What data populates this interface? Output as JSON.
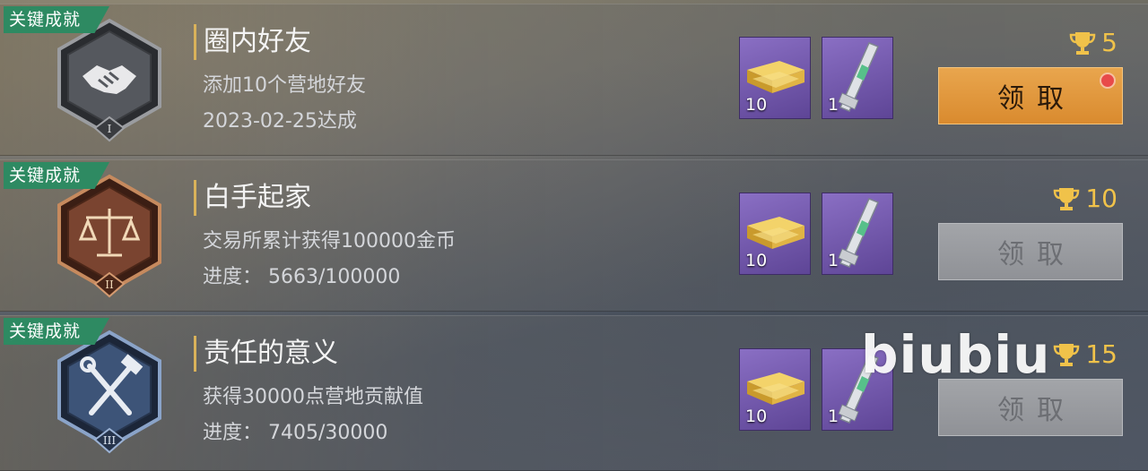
{
  "achievements": [
    {
      "tag": "关键成就",
      "title": "圈内好友",
      "description": "添加10个营地好友",
      "status": "2023-02-25达成",
      "badge_icon": "handshake-icon",
      "badge_tier": "I",
      "badge_color": "#5a5d63",
      "rewards": [
        {
          "icon": "gold-bars-icon",
          "qty": "10"
        },
        {
          "icon": "weapon-icon",
          "qty": "1"
        }
      ],
      "trophy_points": "5",
      "claim_label": "领取",
      "claim_state": "active",
      "has_notification": true
    },
    {
      "tag": "关键成就",
      "title": "白手起家",
      "description": "交易所累计获得100000金币",
      "status": "进度： 5663/100000",
      "badge_icon": "scales-icon",
      "badge_tier": "II",
      "badge_color": "#6b3c28",
      "rewards": [
        {
          "icon": "gold-bars-icon",
          "qty": "10"
        },
        {
          "icon": "weapon-icon",
          "qty": "1"
        }
      ],
      "trophy_points": "10",
      "claim_label": "领取",
      "claim_state": "disabled",
      "has_notification": false
    },
    {
      "tag": "关键成就",
      "title": "责任的意义",
      "description": "获得30000点营地贡献值",
      "status": "进度： 7405/30000",
      "badge_icon": "hammer-wrench-icon",
      "badge_tier": "III",
      "badge_color": "#3a4f72",
      "rewards": [
        {
          "icon": "gold-bars-icon",
          "qty": "10"
        },
        {
          "icon": "weapon-icon",
          "qty": "1"
        }
      ],
      "trophy_points": "15",
      "claim_label": "领取",
      "claim_state": "disabled",
      "has_notification": false
    }
  ],
  "watermark": "biubiu",
  "colors": {
    "tag_green": "#2e8a62",
    "title_bar_gold": "#d9b25a",
    "trophy_gold": "#f0c24a",
    "claim_active": "#e39a3e",
    "claim_disabled": "#999ba0",
    "reward_purple": "#6f55aa"
  }
}
